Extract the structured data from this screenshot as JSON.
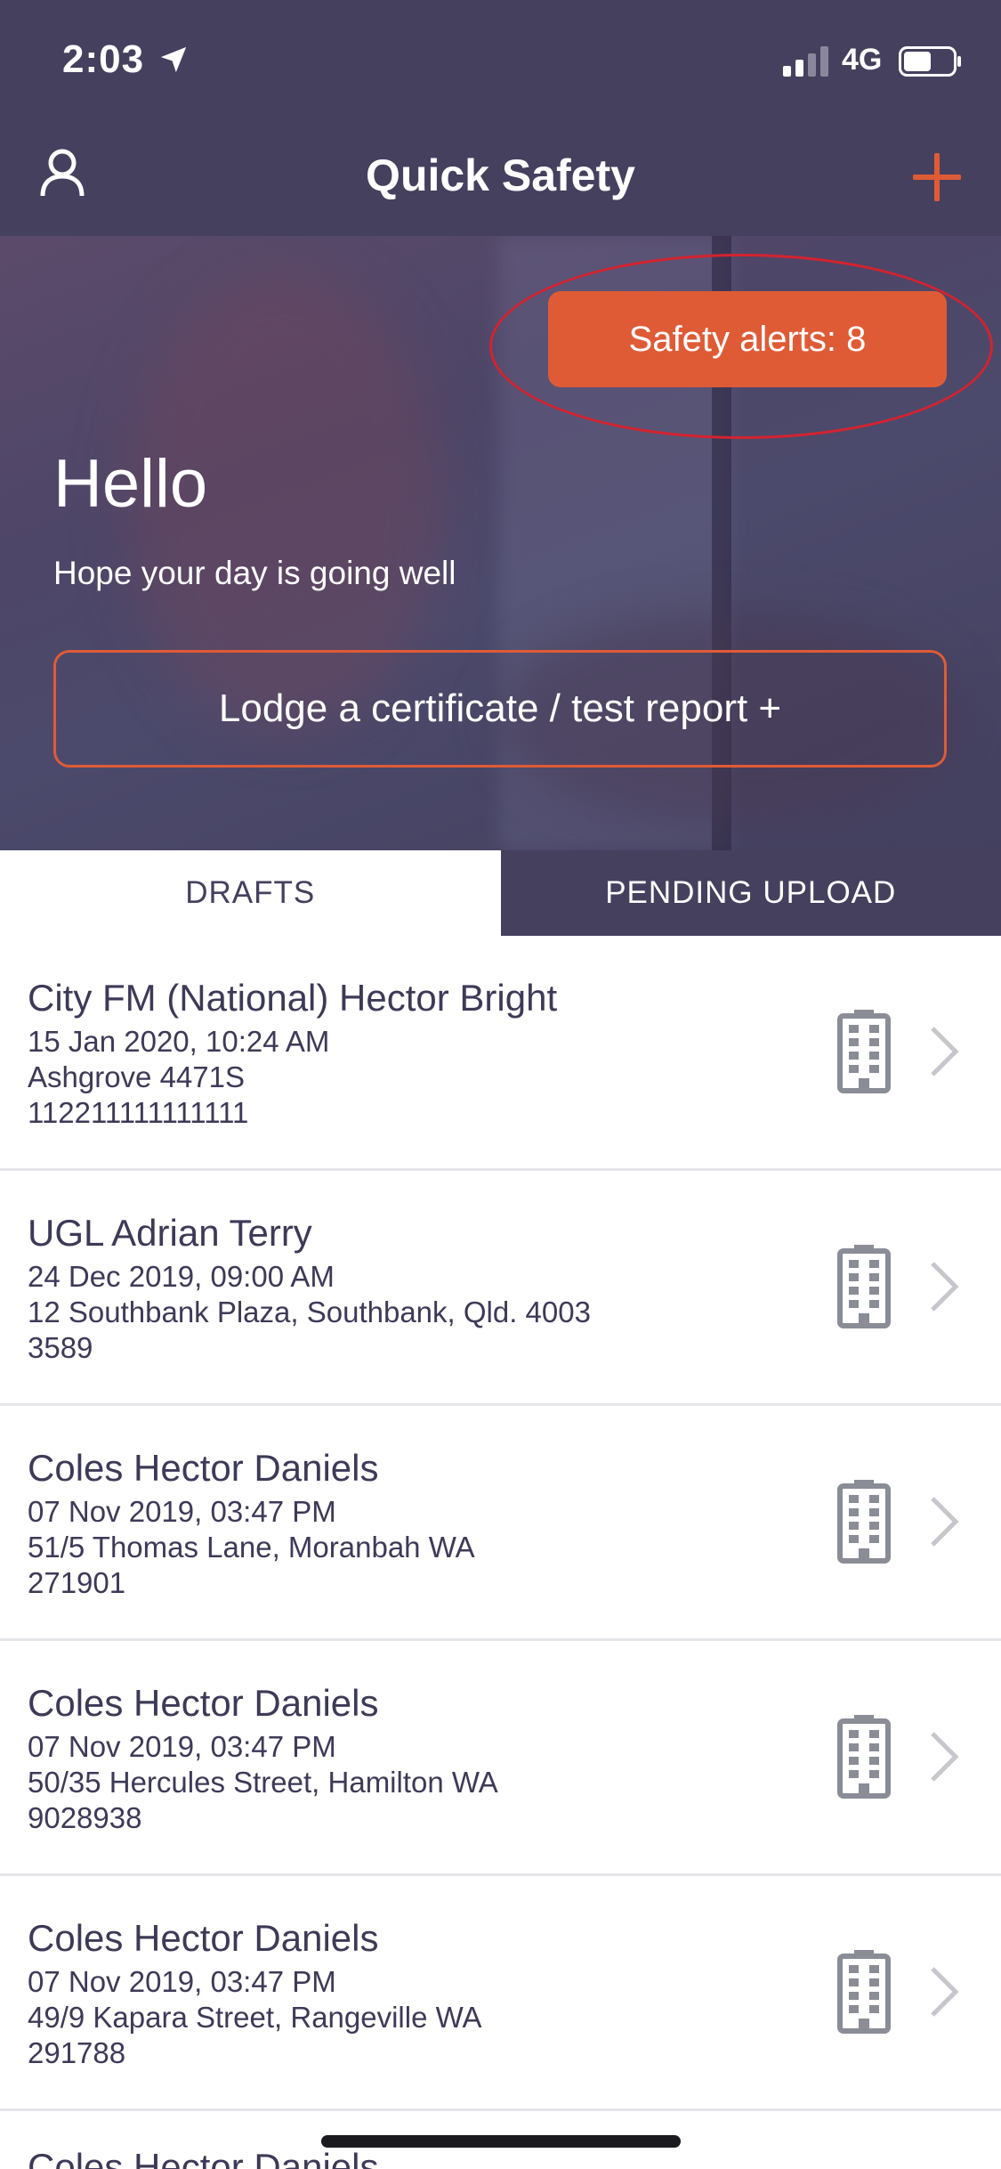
{
  "status_bar": {
    "time": "2:03",
    "network": "4G"
  },
  "nav": {
    "title": "Quick Safety"
  },
  "hero": {
    "alerts_label": "Safety alerts: 8",
    "greeting": "Hello",
    "subtitle": "Hope your day is going well",
    "lodge_label": "Lodge a certificate / test report +"
  },
  "tabs": [
    {
      "label": "DRAFTS"
    },
    {
      "label": "PENDING UPLOAD"
    }
  ],
  "drafts": [
    {
      "title": "City FM (National) Hector Bright",
      "date": "15 Jan 2020, 10:24 AM",
      "address": "Ashgrove 4471S",
      "ref": "112211111111111"
    },
    {
      "title": "UGL Adrian Terry",
      "date": "24 Dec 2019, 09:00 AM",
      "address": "12 Southbank Plaza, Southbank, Qld. 4003",
      "ref": "3589"
    },
    {
      "title": "Coles Hector Daniels",
      "date": "07 Nov 2019, 03:47 PM",
      "address": "51/5 Thomas Lane, Moranbah WA",
      "ref": "271901"
    },
    {
      "title": "Coles Hector Daniels",
      "date": "07 Nov 2019, 03:47 PM",
      "address": "50/35 Hercules Street, Hamilton WA",
      "ref": "9028938"
    },
    {
      "title": "Coles Hector Daniels",
      "date": "07 Nov 2019, 03:47 PM",
      "address": "49/9 Kapara Street, Rangeville WA",
      "ref": "291788"
    }
  ],
  "partial_row_title": "Coles Hector Daniels",
  "colors": {
    "brand_dark": "#45405e",
    "accent": "#df5b36",
    "highlight_ring": "#d3232f"
  },
  "icons": [
    "location-arrow-icon",
    "signal-icon",
    "battery-icon",
    "user-icon",
    "add-icon",
    "building-icon",
    "chevron-right-icon"
  ]
}
